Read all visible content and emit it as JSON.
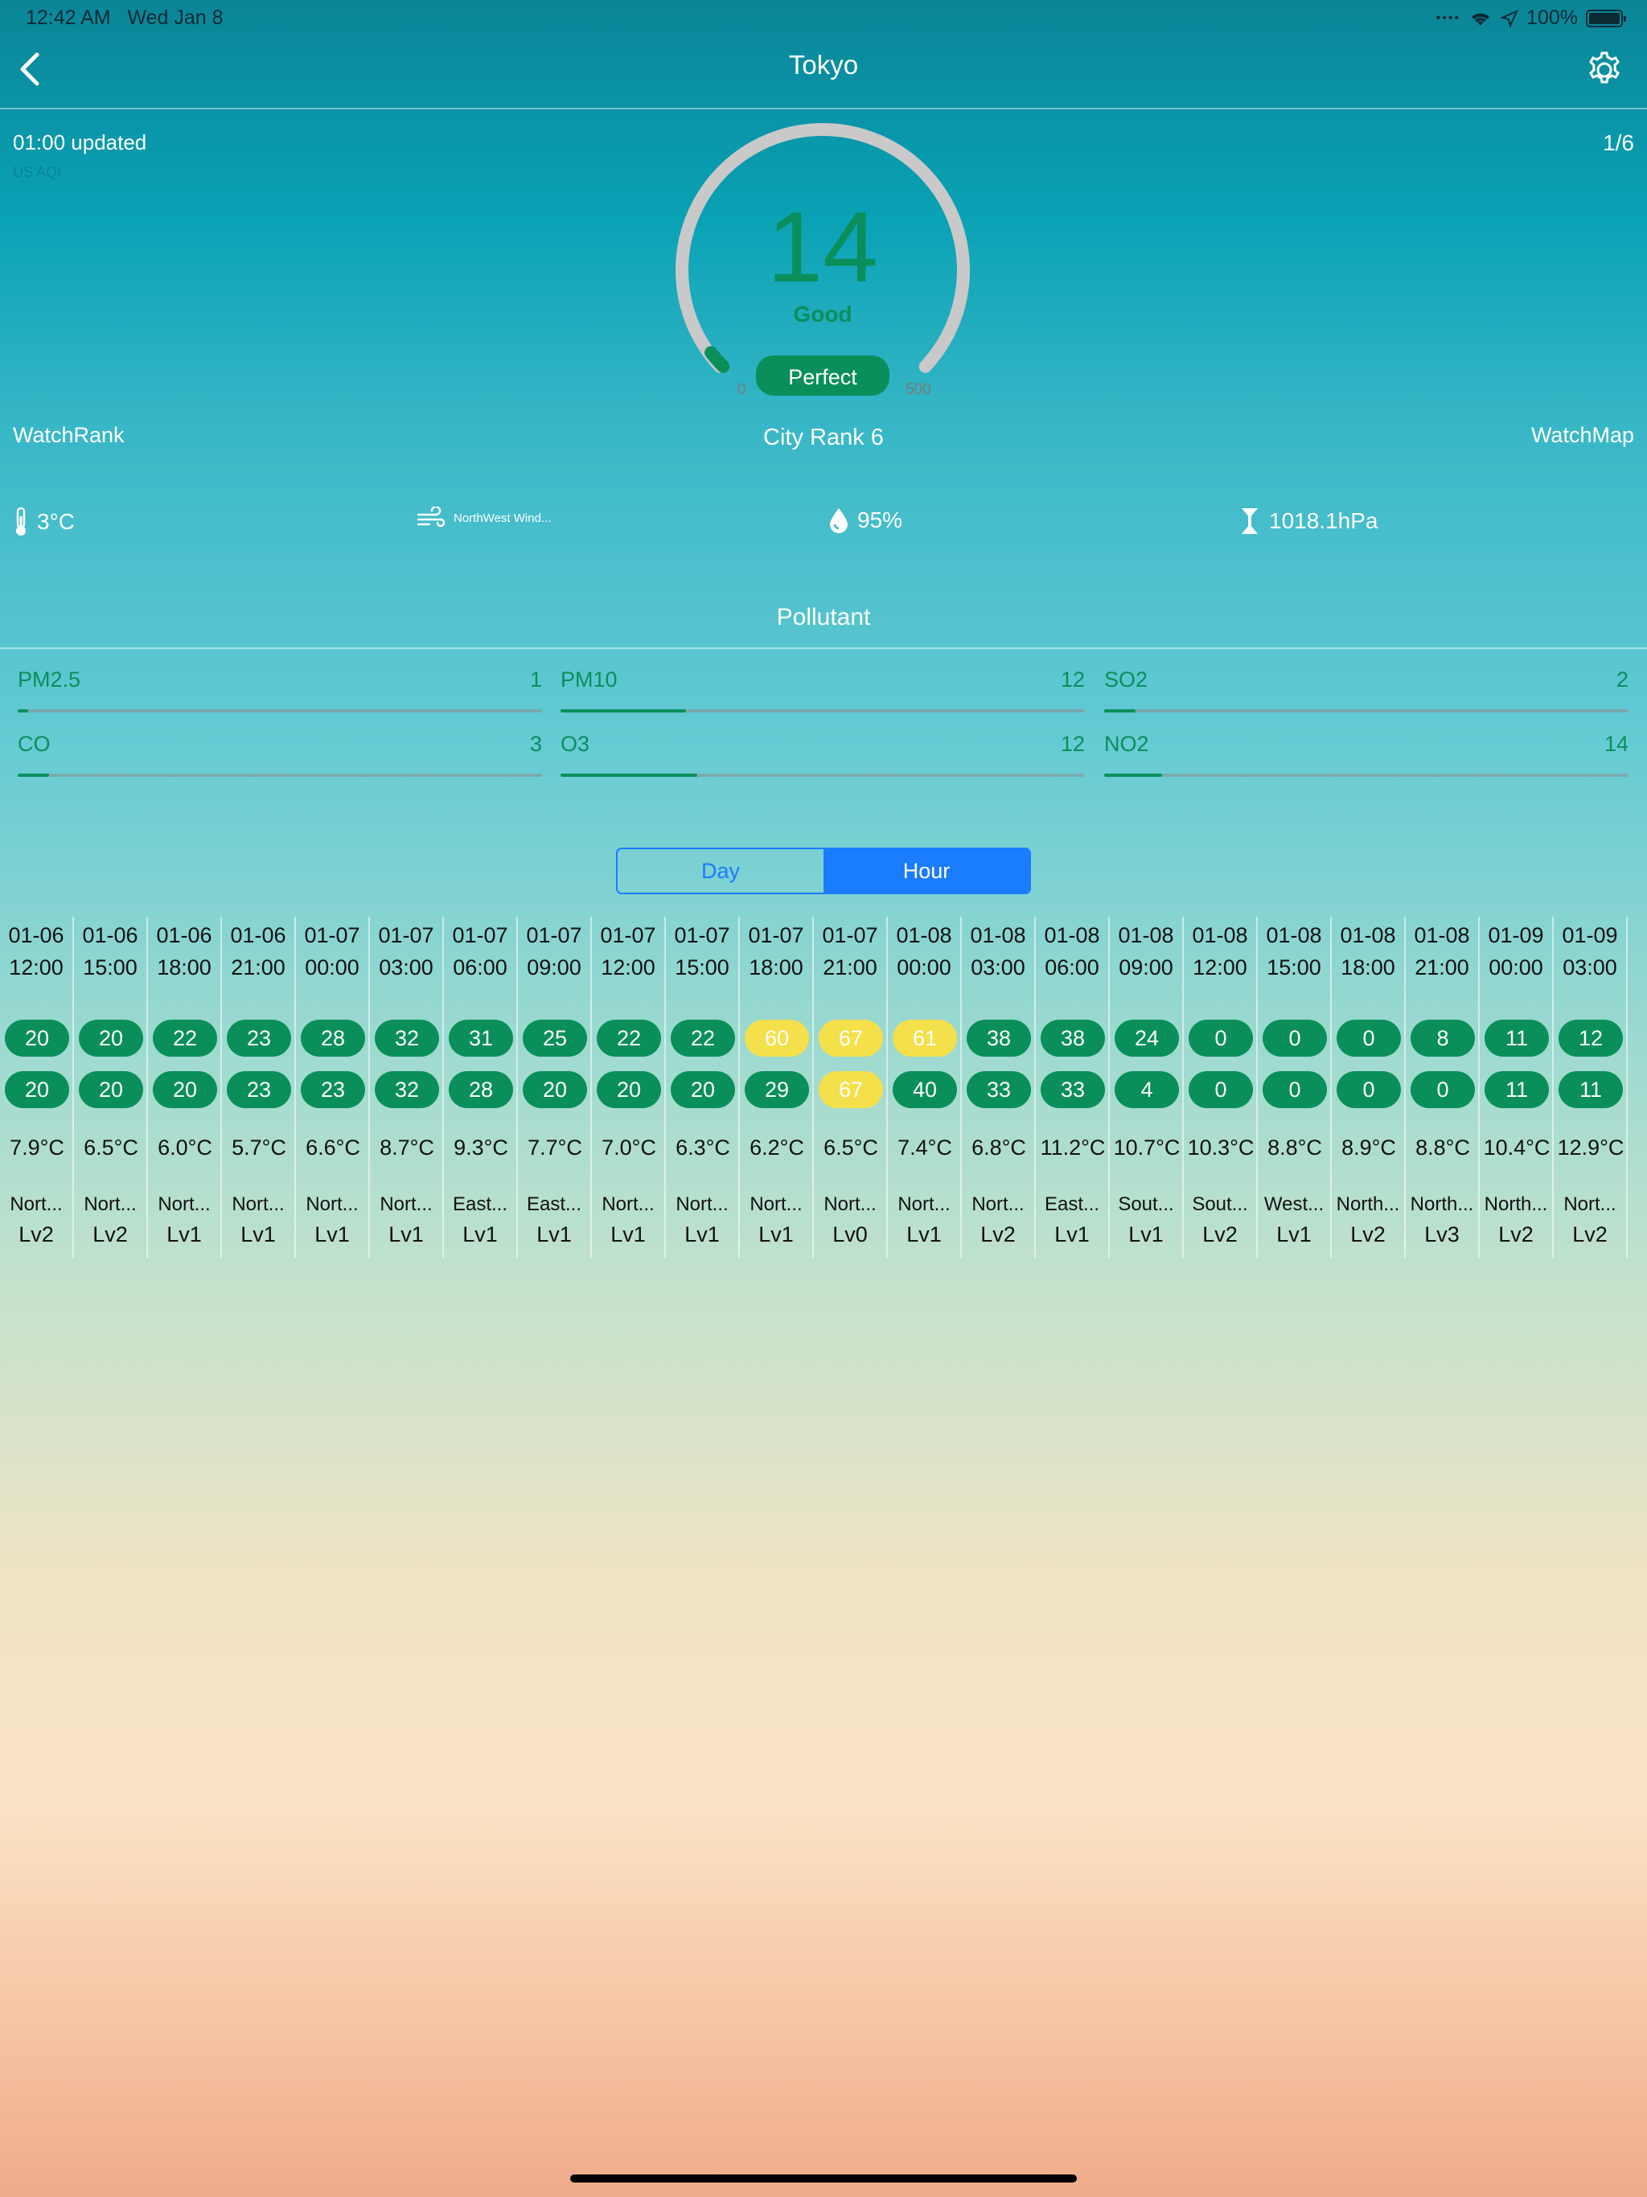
{
  "status_bar": {
    "time": "12:42 AM",
    "date": "Wed Jan 8",
    "battery": "100%"
  },
  "nav": {
    "title": "Tokyo"
  },
  "info": {
    "updated": "01:00 updated",
    "sub": "US AQI",
    "page": "1/6"
  },
  "gauge": {
    "value": "14",
    "label": "Good",
    "badge": "Perfect",
    "min": "0",
    "max": "500",
    "level_fraction": 0.028
  },
  "links": {
    "watch_rank": "WatchRank",
    "city_rank": "City Rank 6",
    "watch_map": "WatchMap"
  },
  "weather": {
    "temp": "3°C",
    "wind": "NorthWest Wind...",
    "humidity": "95%",
    "pressure": "1018.1hPa"
  },
  "pollutant": {
    "title": "Pollutant",
    "items": [
      {
        "name": "PM2.5",
        "value": "1",
        "level": 0.02
      },
      {
        "name": "PM10",
        "value": "12",
        "level": 0.24
      },
      {
        "name": "SO2",
        "value": "2",
        "level": 0.06
      },
      {
        "name": "CO",
        "value": "3",
        "level": 0.06
      },
      {
        "name": "O3",
        "value": "12",
        "level": 0.26
      },
      {
        "name": "NO2",
        "value": "14",
        "level": 0.11
      }
    ]
  },
  "segment": {
    "day": "Day",
    "hour": "Hour",
    "selected": "Hour"
  },
  "colors": {
    "good": "#0a8f5a",
    "moderate": "#f4e04a",
    "accent": "#1a7cff"
  },
  "hours": [
    {
      "date": "01-06",
      "time": "12:00",
      "v1": "20",
      "c1": "good",
      "v2": "20",
      "c2": "good",
      "temp": "7.9°C",
      "wind": "Nort...",
      "lv": "Lv2"
    },
    {
      "date": "01-06",
      "time": "15:00",
      "v1": "20",
      "c1": "good",
      "v2": "20",
      "c2": "good",
      "temp": "6.5°C",
      "wind": "Nort...",
      "lv": "Lv2"
    },
    {
      "date": "01-06",
      "time": "18:00",
      "v1": "22",
      "c1": "good",
      "v2": "20",
      "c2": "good",
      "temp": "6.0°C",
      "wind": "Nort...",
      "lv": "Lv1"
    },
    {
      "date": "01-06",
      "time": "21:00",
      "v1": "23",
      "c1": "good",
      "v2": "23",
      "c2": "good",
      "temp": "5.7°C",
      "wind": "Nort...",
      "lv": "Lv1"
    },
    {
      "date": "01-07",
      "time": "00:00",
      "v1": "28",
      "c1": "good",
      "v2": "23",
      "c2": "good",
      "temp": "6.6°C",
      "wind": "Nort...",
      "lv": "Lv1"
    },
    {
      "date": "01-07",
      "time": "03:00",
      "v1": "32",
      "c1": "good",
      "v2": "32",
      "c2": "good",
      "temp": "8.7°C",
      "wind": "Nort...",
      "lv": "Lv1"
    },
    {
      "date": "01-07",
      "time": "06:00",
      "v1": "31",
      "c1": "good",
      "v2": "28",
      "c2": "good",
      "temp": "9.3°C",
      "wind": "East...",
      "lv": "Lv1"
    },
    {
      "date": "01-07",
      "time": "09:00",
      "v1": "25",
      "c1": "good",
      "v2": "20",
      "c2": "good",
      "temp": "7.7°C",
      "wind": "East...",
      "lv": "Lv1"
    },
    {
      "date": "01-07",
      "time": "12:00",
      "v1": "22",
      "c1": "good",
      "v2": "20",
      "c2": "good",
      "temp": "7.0°C",
      "wind": "Nort...",
      "lv": "Lv1"
    },
    {
      "date": "01-07",
      "time": "15:00",
      "v1": "22",
      "c1": "good",
      "v2": "20",
      "c2": "good",
      "temp": "6.3°C",
      "wind": "Nort...",
      "lv": "Lv1"
    },
    {
      "date": "01-07",
      "time": "18:00",
      "v1": "60",
      "c1": "moderate",
      "v2": "29",
      "c2": "good",
      "temp": "6.2°C",
      "wind": "Nort...",
      "lv": "Lv1"
    },
    {
      "date": "01-07",
      "time": "21:00",
      "v1": "67",
      "c1": "moderate",
      "v2": "67",
      "c2": "moderate",
      "temp": "6.5°C",
      "wind": "Nort...",
      "lv": "Lv0"
    },
    {
      "date": "01-08",
      "time": "00:00",
      "v1": "61",
      "c1": "moderate",
      "v2": "40",
      "c2": "good",
      "temp": "7.4°C",
      "wind": "Nort...",
      "lv": "Lv1"
    },
    {
      "date": "01-08",
      "time": "03:00",
      "v1": "38",
      "c1": "good",
      "v2": "33",
      "c2": "good",
      "temp": "6.8°C",
      "wind": "Nort...",
      "lv": "Lv2"
    },
    {
      "date": "01-08",
      "time": "06:00",
      "v1": "38",
      "c1": "good",
      "v2": "33",
      "c2": "good",
      "temp": "11.2°C",
      "wind": "East...",
      "lv": "Lv1"
    },
    {
      "date": "01-08",
      "time": "09:00",
      "v1": "24",
      "c1": "good",
      "v2": "4",
      "c2": "good",
      "temp": "10.7°C",
      "wind": "Sout...",
      "lv": "Lv1"
    },
    {
      "date": "01-08",
      "time": "12:00",
      "v1": "0",
      "c1": "good",
      "v2": "0",
      "c2": "good",
      "temp": "10.3°C",
      "wind": "Sout...",
      "lv": "Lv2"
    },
    {
      "date": "01-08",
      "time": "15:00",
      "v1": "0",
      "c1": "good",
      "v2": "0",
      "c2": "good",
      "temp": "8.8°C",
      "wind": "West...",
      "lv": "Lv1"
    },
    {
      "date": "01-08",
      "time": "18:00",
      "v1": "0",
      "c1": "good",
      "v2": "0",
      "c2": "good",
      "temp": "8.9°C",
      "wind": "North...",
      "lv": "Lv2"
    },
    {
      "date": "01-08",
      "time": "21:00",
      "v1": "8",
      "c1": "good",
      "v2": "0",
      "c2": "good",
      "temp": "8.8°C",
      "wind": "North...",
      "lv": "Lv3"
    },
    {
      "date": "01-09",
      "time": "00:00",
      "v1": "11",
      "c1": "good",
      "v2": "11",
      "c2": "good",
      "temp": "10.4°C",
      "wind": "North...",
      "lv": "Lv2"
    },
    {
      "date": "01-09",
      "time": "03:00",
      "v1": "12",
      "c1": "good",
      "v2": "11",
      "c2": "good",
      "temp": "12.9°C",
      "wind": "Nort...",
      "lv": "Lv2"
    }
  ]
}
